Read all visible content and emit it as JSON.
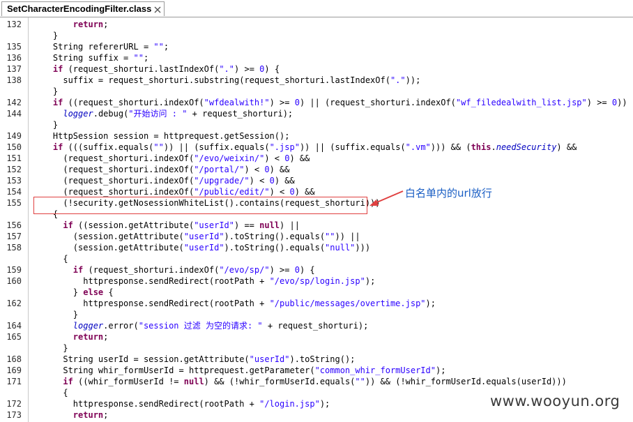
{
  "tab": {
    "title": "SetCharacterEncodingFilter.class",
    "close": "✕"
  },
  "lines": [
    {
      "n": "132",
      "segs": [
        [
          "p",
          "        "
        ],
        [
          "kw",
          "return"
        ],
        [
          "p",
          ";"
        ]
      ]
    },
    {
      "n": "",
      "segs": [
        [
          "p",
          "    }"
        ]
      ]
    },
    {
      "n": "135",
      "segs": [
        [
          "p",
          "    String refererURL = "
        ],
        [
          "str",
          "\"\""
        ],
        [
          "p",
          ";"
        ]
      ]
    },
    {
      "n": "136",
      "segs": [
        [
          "p",
          "    String suffix = "
        ],
        [
          "str",
          "\"\""
        ],
        [
          "p",
          ";"
        ]
      ]
    },
    {
      "n": "137",
      "segs": [
        [
          "p",
          "    "
        ],
        [
          "kw",
          "if"
        ],
        [
          "p",
          " (request_shorturi.lastIndexOf("
        ],
        [
          "str",
          "\".\""
        ],
        [
          "p",
          ") >= "
        ],
        [
          "num",
          "0"
        ],
        [
          "p",
          ") {"
        ]
      ]
    },
    {
      "n": "138",
      "segs": [
        [
          "p",
          "      suffix = request_shorturi.substring(request_shorturi.lastIndexOf("
        ],
        [
          "str",
          "\".\""
        ],
        [
          "p",
          "));"
        ]
      ]
    },
    {
      "n": "",
      "segs": [
        [
          "p",
          "    }"
        ]
      ]
    },
    {
      "n": "142",
      "segs": [
        [
          "p",
          "    "
        ],
        [
          "kw",
          "if"
        ],
        [
          "p",
          " ((request_shorturi.indexOf("
        ],
        [
          "str",
          "\"wfdealwith!\""
        ],
        [
          "p",
          ") >= "
        ],
        [
          "num",
          "0"
        ],
        [
          "p",
          ") || (request_shorturi.indexOf("
        ],
        [
          "str",
          "\"wf_filedealwith_list.jsp\""
        ],
        [
          "p",
          ") >= "
        ],
        [
          "num",
          "0"
        ],
        [
          "p",
          ")) {"
        ]
      ]
    },
    {
      "n": "144",
      "segs": [
        [
          "p",
          "      "
        ],
        [
          "fld",
          "logger"
        ],
        [
          "p",
          ".debug("
        ],
        [
          "str",
          "\"开始访问 : \""
        ],
        [
          "p",
          " + request_shorturi);"
        ]
      ]
    },
    {
      "n": "",
      "segs": [
        [
          "p",
          "    }"
        ]
      ]
    },
    {
      "n": "149",
      "segs": [
        [
          "p",
          "    HttpSession session = httprequest.getSession();"
        ]
      ]
    },
    {
      "n": "150",
      "segs": [
        [
          "p",
          "    "
        ],
        [
          "kw",
          "if"
        ],
        [
          "p",
          " (((suffix.equals("
        ],
        [
          "str",
          "\"\""
        ],
        [
          "p",
          ")) || (suffix.equals("
        ],
        [
          "str",
          "\".jsp\""
        ],
        [
          "p",
          ")) || (suffix.equals("
        ],
        [
          "str",
          "\".vm\""
        ],
        [
          "p",
          "))) && ("
        ],
        [
          "kw",
          "this"
        ],
        [
          "p",
          "."
        ],
        [
          "fld",
          "needSecurity"
        ],
        [
          "p",
          ") &&"
        ]
      ]
    },
    {
      "n": "151",
      "segs": [
        [
          "p",
          "      (request_shorturi.indexOf("
        ],
        [
          "str",
          "\"/evo/weixin/\""
        ],
        [
          "p",
          ") < "
        ],
        [
          "num",
          "0"
        ],
        [
          "p",
          ") &&"
        ]
      ]
    },
    {
      "n": "152",
      "segs": [
        [
          "p",
          "      (request_shorturi.indexOf("
        ],
        [
          "str",
          "\"/portal/\""
        ],
        [
          "p",
          ") < "
        ],
        [
          "num",
          "0"
        ],
        [
          "p",
          ") &&"
        ]
      ]
    },
    {
      "n": "153",
      "segs": [
        [
          "p",
          "      (request_shorturi.indexOf("
        ],
        [
          "str",
          "\"/upgrade/\""
        ],
        [
          "p",
          ") < "
        ],
        [
          "num",
          "0"
        ],
        [
          "p",
          ") &&"
        ]
      ]
    },
    {
      "n": "154",
      "segs": [
        [
          "p",
          "      (request_shorturi.indexOf("
        ],
        [
          "str",
          "\"/public/edit/\""
        ],
        [
          "p",
          ") < "
        ],
        [
          "num",
          "0"
        ],
        [
          "p",
          ") &&"
        ]
      ]
    },
    {
      "n": "155",
      "segs": [
        [
          "p",
          "      (!security.getNosessionWhiteList().contains(request_shorturi)))"
        ]
      ]
    },
    {
      "n": "",
      "segs": [
        [
          "p",
          "    {"
        ]
      ]
    },
    {
      "n": "156",
      "segs": [
        [
          "p",
          "      "
        ],
        [
          "kw",
          "if"
        ],
        [
          "p",
          " ((session.getAttribute("
        ],
        [
          "str",
          "\"userId\""
        ],
        [
          "p",
          ") == "
        ],
        [
          "kw",
          "null"
        ],
        [
          "p",
          ") ||"
        ]
      ]
    },
    {
      "n": "157",
      "segs": [
        [
          "p",
          "        (session.getAttribute("
        ],
        [
          "str",
          "\"userId\""
        ],
        [
          "p",
          ").toString().equals("
        ],
        [
          "str",
          "\"\""
        ],
        [
          "p",
          ")) ||"
        ]
      ]
    },
    {
      "n": "158",
      "segs": [
        [
          "p",
          "        (session.getAttribute("
        ],
        [
          "str",
          "\"userId\""
        ],
        [
          "p",
          ").toString().equals("
        ],
        [
          "str",
          "\"null\""
        ],
        [
          "p",
          ")))"
        ]
      ]
    },
    {
      "n": "",
      "segs": [
        [
          "p",
          "      {"
        ]
      ]
    },
    {
      "n": "159",
      "segs": [
        [
          "p",
          "        "
        ],
        [
          "kw",
          "if"
        ],
        [
          "p",
          " (request_shorturi.indexOf("
        ],
        [
          "str",
          "\"/evo/sp/\""
        ],
        [
          "p",
          ") >= "
        ],
        [
          "num",
          "0"
        ],
        [
          "p",
          ") {"
        ]
      ]
    },
    {
      "n": "160",
      "segs": [
        [
          "p",
          "          httpresponse.sendRedirect(rootPath + "
        ],
        [
          "str",
          "\"/evo/sp/login.jsp\""
        ],
        [
          "p",
          ");"
        ]
      ]
    },
    {
      "n": "",
      "segs": [
        [
          "p",
          "        } "
        ],
        [
          "kw",
          "else"
        ],
        [
          "p",
          " {"
        ]
      ]
    },
    {
      "n": "162",
      "segs": [
        [
          "p",
          "          httpresponse.sendRedirect(rootPath + "
        ],
        [
          "str",
          "\"/public/messages/overtime.jsp\""
        ],
        [
          "p",
          ");"
        ]
      ]
    },
    {
      "n": "",
      "segs": [
        [
          "p",
          "        }"
        ]
      ]
    },
    {
      "n": "164",
      "segs": [
        [
          "p",
          "        "
        ],
        [
          "fld",
          "logger"
        ],
        [
          "p",
          ".error("
        ],
        [
          "str",
          "\"session 过滤 为空的请求: \""
        ],
        [
          "p",
          " + request_shorturi);"
        ]
      ]
    },
    {
      "n": "165",
      "segs": [
        [
          "p",
          "        "
        ],
        [
          "kw",
          "return"
        ],
        [
          "p",
          ";"
        ]
      ]
    },
    {
      "n": "",
      "segs": [
        [
          "p",
          "      }"
        ]
      ]
    },
    {
      "n": "168",
      "segs": [
        [
          "p",
          "      String userId = session.getAttribute("
        ],
        [
          "str",
          "\"userId\""
        ],
        [
          "p",
          ").toString();"
        ]
      ]
    },
    {
      "n": "169",
      "segs": [
        [
          "p",
          "      String whir_formUserId = httprequest.getParameter("
        ],
        [
          "str",
          "\"common_whir_formUserId\""
        ],
        [
          "p",
          ");"
        ]
      ]
    },
    {
      "n": "171",
      "segs": [
        [
          "p",
          "      "
        ],
        [
          "kw",
          "if"
        ],
        [
          "p",
          " ((whir_formUserId != "
        ],
        [
          "kw",
          "null"
        ],
        [
          "p",
          ") && (!whir_formUserId.equals("
        ],
        [
          "str",
          "\"\""
        ],
        [
          "p",
          ")) && (!whir_formUserId.equals(userId)))"
        ]
      ]
    },
    {
      "n": "",
      "segs": [
        [
          "p",
          "      {"
        ]
      ]
    },
    {
      "n": "172",
      "segs": [
        [
          "p",
          "        httpresponse.sendRedirect(rootPath + "
        ],
        [
          "str",
          "\"/login.jsp\""
        ],
        [
          "p",
          ");"
        ]
      ]
    },
    {
      "n": "173",
      "segs": [
        [
          "p",
          "        "
        ],
        [
          "kw",
          "return"
        ],
        [
          "p",
          ";"
        ]
      ]
    }
  ],
  "annotation": {
    "text": "白名单内的url放行",
    "color": "#e04040",
    "text_color": "#1a5ec4"
  },
  "watermark": "www.wooyun.org",
  "colors": {
    "keyword": "#7f0055",
    "string": "#2a00ff",
    "field": "#0000c0"
  }
}
